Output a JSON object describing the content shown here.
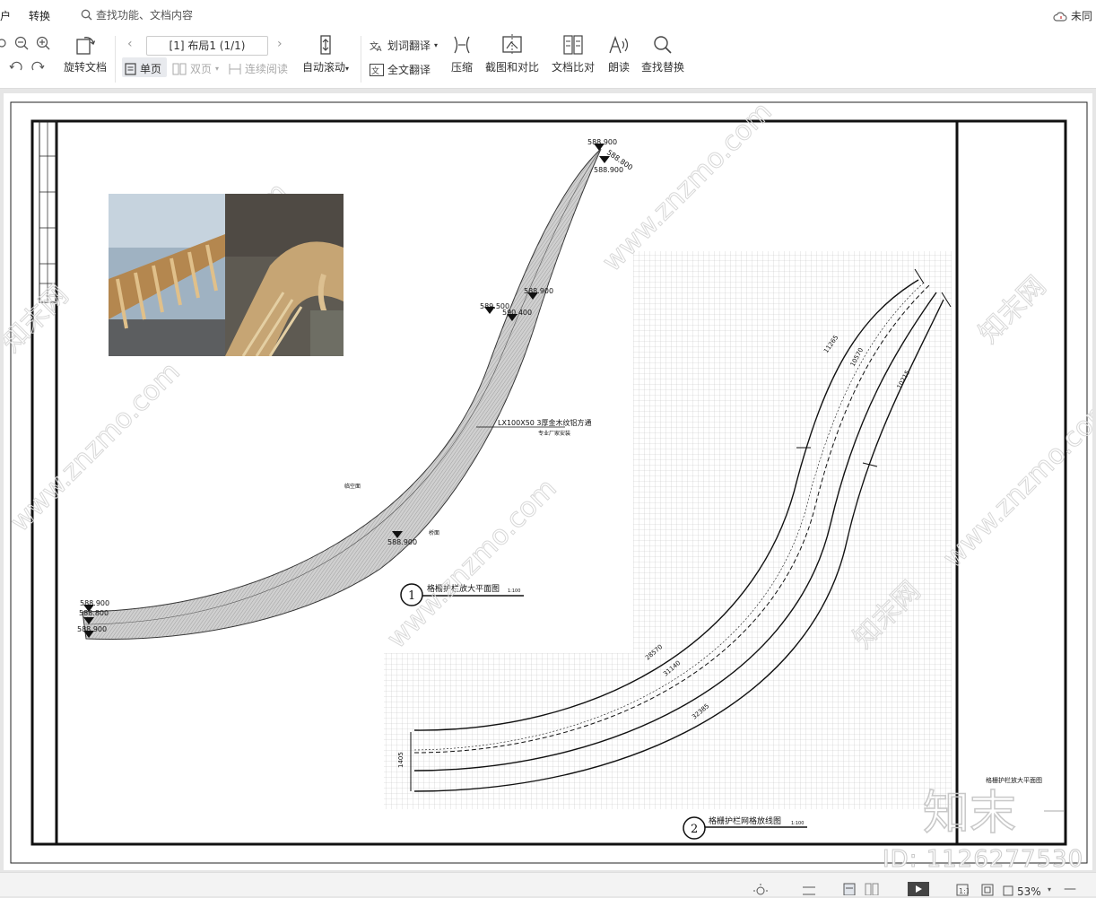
{
  "topbar": {
    "tab_left_fragment": "户",
    "tab_convert": "转换",
    "search_placeholder": "查找功能、文档内容",
    "cloud_status": "未同"
  },
  "toolbar": {
    "rotate_doc": "旋转文档",
    "page_indicator": "[1] 布局1 (1/1)",
    "single_page": "单页",
    "double_page": "双页",
    "continuous_read": "连续阅读",
    "auto_scroll": "自动滚动",
    "word_translate": "划词翻译",
    "full_translate": "全文翻译",
    "compress": "压缩",
    "screenshot_compare": "截图和对比",
    "doc_compare": "文档比对",
    "read_aloud": "朗读",
    "find_replace": "查找替换"
  },
  "drawing": {
    "elev_top_1": "588.900",
    "elev_top_2": "588.800",
    "elev_top_3": "588.900",
    "elev_mid_1": "589.500",
    "elev_mid_2": "590.400",
    "elev_mid_3": "588.900",
    "elev_low": "588.900",
    "elev_left_1": "588.900",
    "elev_left_2": "588.800",
    "elev_left_3": "588.900",
    "callout": "LX100X50  3厚金木纹铝方通",
    "callout_sub": "专业厂家安装",
    "label_a": "临空面",
    "label_b": "桥面",
    "title1_num": "1",
    "title1": "格栅护栏放大平面图",
    "title1_scale": "1:100",
    "title2_num": "2",
    "title2": "格栅护栏网格放线图",
    "title2_scale": "1:100",
    "dim_11265": "11265",
    "dim_10570": "10570",
    "dim_10215": "10215",
    "dim_28570": "28570",
    "dim_31140": "31140",
    "dim_32385": "32385",
    "dim_1405": "1405",
    "titleblock_name": "格栅护栏放大平面图",
    "watermark": "www.znzmo.com",
    "watermark_cn": "知末网",
    "logo": "知末",
    "id_text": "ID: 1126277530"
  },
  "status": {
    "zoom": "53%"
  }
}
